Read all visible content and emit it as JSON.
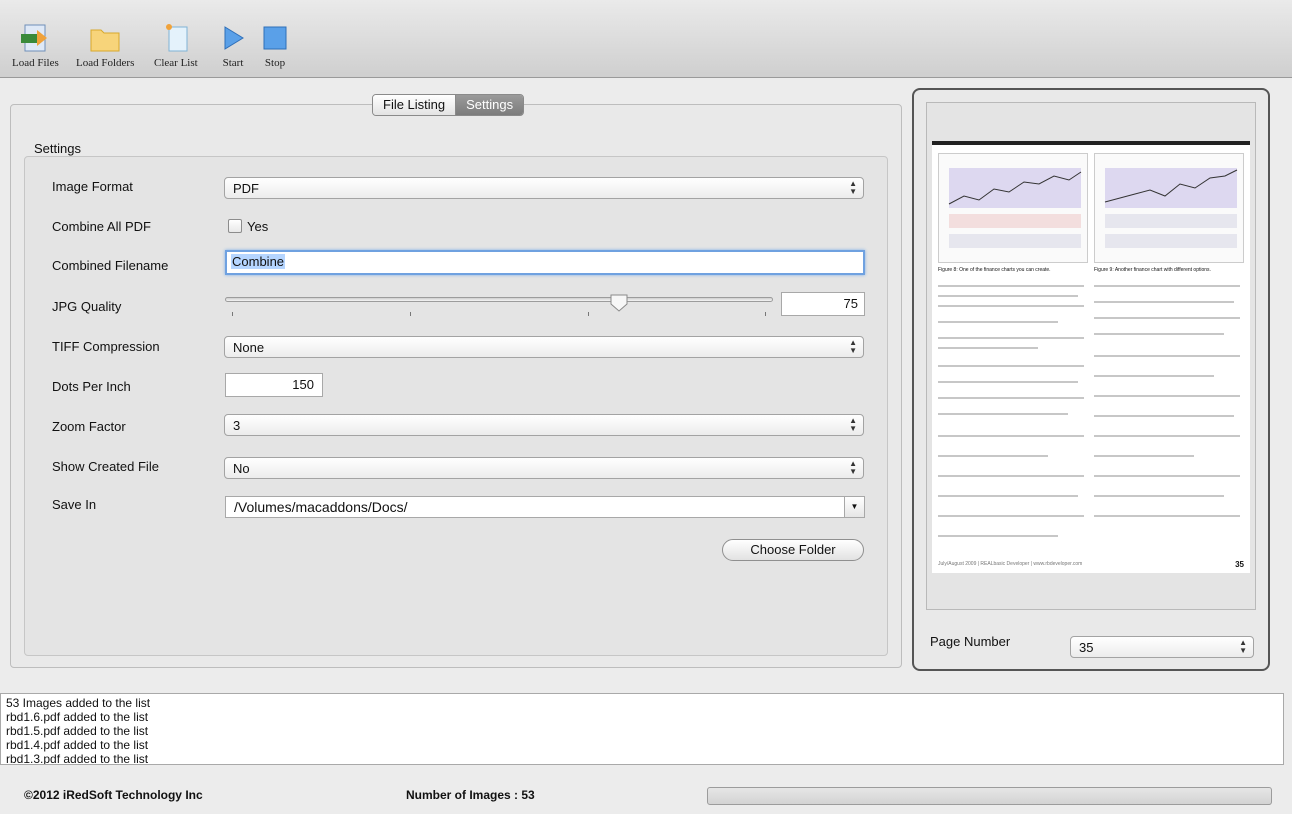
{
  "toolbar": {
    "load_files": "Load Files",
    "load_folders": "Load Folders",
    "clear_list": "Clear List",
    "start": "Start",
    "stop": "Stop"
  },
  "tabs": {
    "file_listing": "File Listing",
    "settings": "Settings"
  },
  "settings": {
    "section_title": "Settings",
    "image_format": {
      "label": "Image Format",
      "value": "PDF"
    },
    "combine_all_pdf": {
      "label": "Combine All PDF",
      "checkbox_label": "Yes",
      "checked": false
    },
    "combined_filename": {
      "label": "Combined Filename",
      "value": "Combine"
    },
    "jpg_quality": {
      "label": "JPG Quality",
      "value": "75"
    },
    "tiff_compression": {
      "label": "TIFF Compression",
      "value": "None"
    },
    "dots_per_inch": {
      "label": "Dots Per Inch",
      "value": "150"
    },
    "zoom_factor": {
      "label": "Zoom Factor",
      "value": "3"
    },
    "show_created_file": {
      "label": "Show Created File",
      "value": "No"
    },
    "save_in": {
      "label": "Save In",
      "value": "/Volumes/macaddons/Docs/"
    },
    "choose_folder": "Choose Folder"
  },
  "preview": {
    "page_number_label": "Page Number",
    "page_number_value": "35",
    "page_footer": "July/August 2009 | REALbasic Developer | www.rbdeveloper.com",
    "page_footer_num": "35",
    "fig_left": "Figure 8: One of the finance charts you can create.",
    "fig_right": "Figure 9: Another finance chart with different options."
  },
  "log": [
    "53 Images added to the list",
    "rbd1.6.pdf added to the list",
    "rbd1.5.pdf added to the list",
    "rbd1.4.pdf added to the list",
    "rbd1.3.pdf added to the list"
  ],
  "status": {
    "copyright": "©2012 iRedSoft Technology Inc",
    "image_count": "Number of Images : 53",
    "progress": 0
  }
}
